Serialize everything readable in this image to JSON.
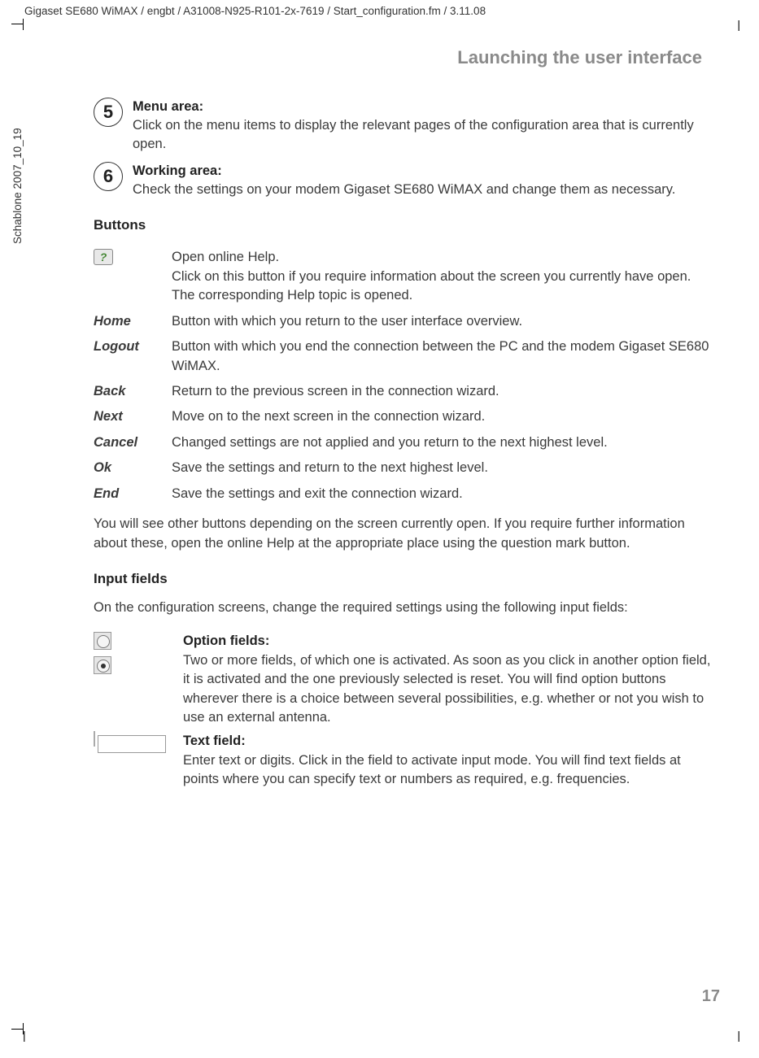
{
  "header_path": "Gigaset SE680 WiMAX / engbt / A31008-N925-R101-2x-7619 / Start_configuration.fm / 3.11.08",
  "side_text": "Schablone 2007_10_19",
  "chapter_title": "Launching the user interface",
  "step5": {
    "num": "5",
    "lead": "Menu area:",
    "body": "Click on the menu items to display the relevant pages of the configuration area that is currently open."
  },
  "step6": {
    "num": "6",
    "lead": "Working area:",
    "body": "Check the settings on your modem Gigaset SE680 WiMAX and change them as necessary."
  },
  "buttons_heading": "Buttons",
  "buttons": [
    {
      "key_icon": "?",
      "desc": "Open online Help.\nClick on this button if you require information about the screen you currently have open. The corresponding Help topic is opened."
    },
    {
      "key": "Home",
      "desc": "Button with which you return to the user interface overview."
    },
    {
      "key": "Logout",
      "desc": "Button with which you end the connection between the PC and the modem Gigaset SE680 WiMAX."
    },
    {
      "key": "Back",
      "desc": "Return to the previous screen in the connection wizard."
    },
    {
      "key": "Next",
      "desc": "Move on to the next screen in the connection wizard."
    },
    {
      "key": "Cancel",
      "desc": "Changed settings are not applied and you return to the next highest level."
    },
    {
      "key": "Ok",
      "desc": "Save the settings and return to the next highest level."
    },
    {
      "key": "End",
      "desc": "Save the settings and exit the connection wizard."
    }
  ],
  "buttons_note": "You will see other buttons depending on the screen currently open. If you require further information about these, open the online Help at the appropriate place using the question mark button.",
  "input_heading": "Input fields",
  "input_intro": "On the configuration screens, change the required settings using the following input fields:",
  "option_fields": {
    "lead": "Option fields:",
    "body": "Two or more fields, of which one is activated. As soon as you click in another option field, it is activated and the one previously selected is reset. You will find option buttons wherever there is a choice between several possibilities, e.g. whether or not you wish to use an external antenna."
  },
  "text_field": {
    "lead": "Text field:",
    "body": "Enter text or digits. Click in the field to activate input mode. You will find text fields at points where you can specify text or numbers as required, e.g. frequencies."
  },
  "page_number": "17"
}
